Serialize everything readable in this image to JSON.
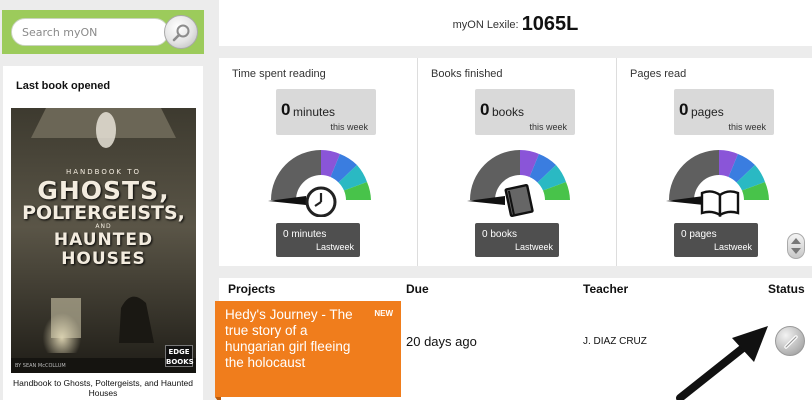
{
  "search": {
    "placeholder": "Search myON"
  },
  "last_book": {
    "heading": "Last book opened",
    "cover": {
      "line1": "HANDBOOK TO",
      "line2": "GHOSTS,",
      "line3": "POLTERGEISTS,",
      "line4": "AND",
      "line5": "HAUNTED HOUSES",
      "author": "BY SEAN McCOLLUM",
      "publisher_logo": "EDGE BOOKS"
    },
    "caption": "Handbook to Ghosts, Poltergeists, and Haunted Houses"
  },
  "header": {
    "lexile_label": "myON Lexile:",
    "lexile_value": "1065L"
  },
  "stats": [
    {
      "title": "Time spent reading",
      "value": "0",
      "unit": "minutes",
      "period": "this week",
      "last_value": "0 minutes",
      "last_label": "Lastweek",
      "icon": "clock-icon",
      "gauge_level": 0
    },
    {
      "title": "Books finished",
      "value": "0",
      "unit": "books",
      "period": "this week",
      "last_value": "0 books",
      "last_label": "Lastweek",
      "icon": "book-icon",
      "gauge_level": 0
    },
    {
      "title": "Pages read",
      "value": "0",
      "unit": "pages",
      "period": "this week",
      "last_value": "0 pages",
      "last_label": "Lastweek",
      "icon": "open-book-icon",
      "gauge_level": 0
    }
  ],
  "gauge_colors": {
    "gray": "#5f5f5f",
    "purple": "#8a55d8",
    "blue": "#3a7de0",
    "teal": "#2ab9c3",
    "green": "#48c34a"
  },
  "projects": {
    "columns": {
      "project": "Projects",
      "due": "Due",
      "teacher": "Teacher",
      "status": "Status"
    },
    "rows": [
      {
        "title": "Hedy's Journey - The true story of a hungarian girl fleeing the holocaust",
        "badge": "NEW",
        "due": "20 days ago",
        "teacher": "J. DIAZ CRUZ",
        "status_icon": "pencil-icon"
      }
    ]
  },
  "colors": {
    "accent_green": "#9ccb5b",
    "project_orange": "#f07d1c",
    "panel_dark": "#4f4f4f"
  }
}
